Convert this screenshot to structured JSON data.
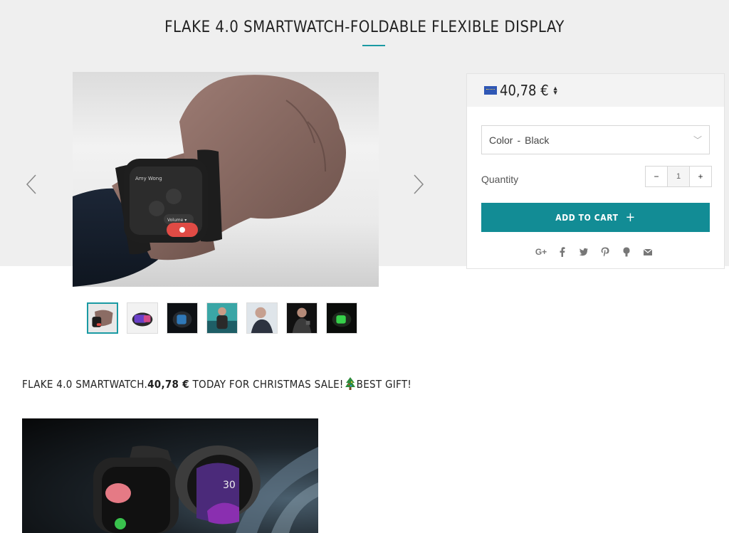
{
  "product": {
    "title": "FLAKE 4.0 SMARTWATCH-FOLDABLE FLEXIBLE DISPLAY"
  },
  "gallery": {
    "prev_icon": "chevron-left-icon",
    "next_icon": "chevron-right-icon",
    "thumbnail_count": 7,
    "active_thumbnail": 1,
    "main_image_screen": {
      "caller": "Amy Wong",
      "volume_label": "Volume ▾"
    }
  },
  "buy_box": {
    "currency_flag": "eu-flag-icon",
    "price": "40,78 €",
    "price_sort_icon": "sort-arrows-icon",
    "variant_select": {
      "label": "Color",
      "separator": "-",
      "value": "Black"
    },
    "quantity_label": "Quantity",
    "quantity_minus": "−",
    "quantity_value": "1",
    "quantity_plus": "+",
    "add_to_cart_label": "ADD TO CART",
    "add_to_cart_icon": "+",
    "share_icons": [
      "google-plus-icon",
      "facebook-icon",
      "twitter-icon",
      "pinterest-icon",
      "fancy-icon",
      "email-icon"
    ]
  },
  "promo": {
    "text_before": "FLAKE 4.0 SMARTWATCH.",
    "price_bold": "40,78 €",
    "text_middle": " TODAY FOR CHRISTMAS SALE!",
    "text_after": "BEST GIFT!",
    "emoji_icon": "christmas-tree-icon"
  },
  "banner": {
    "watch_time": "30"
  },
  "colors": {
    "accent": "#128c95",
    "title_underline": "#1a9aa3",
    "top_band": "#efefef"
  }
}
